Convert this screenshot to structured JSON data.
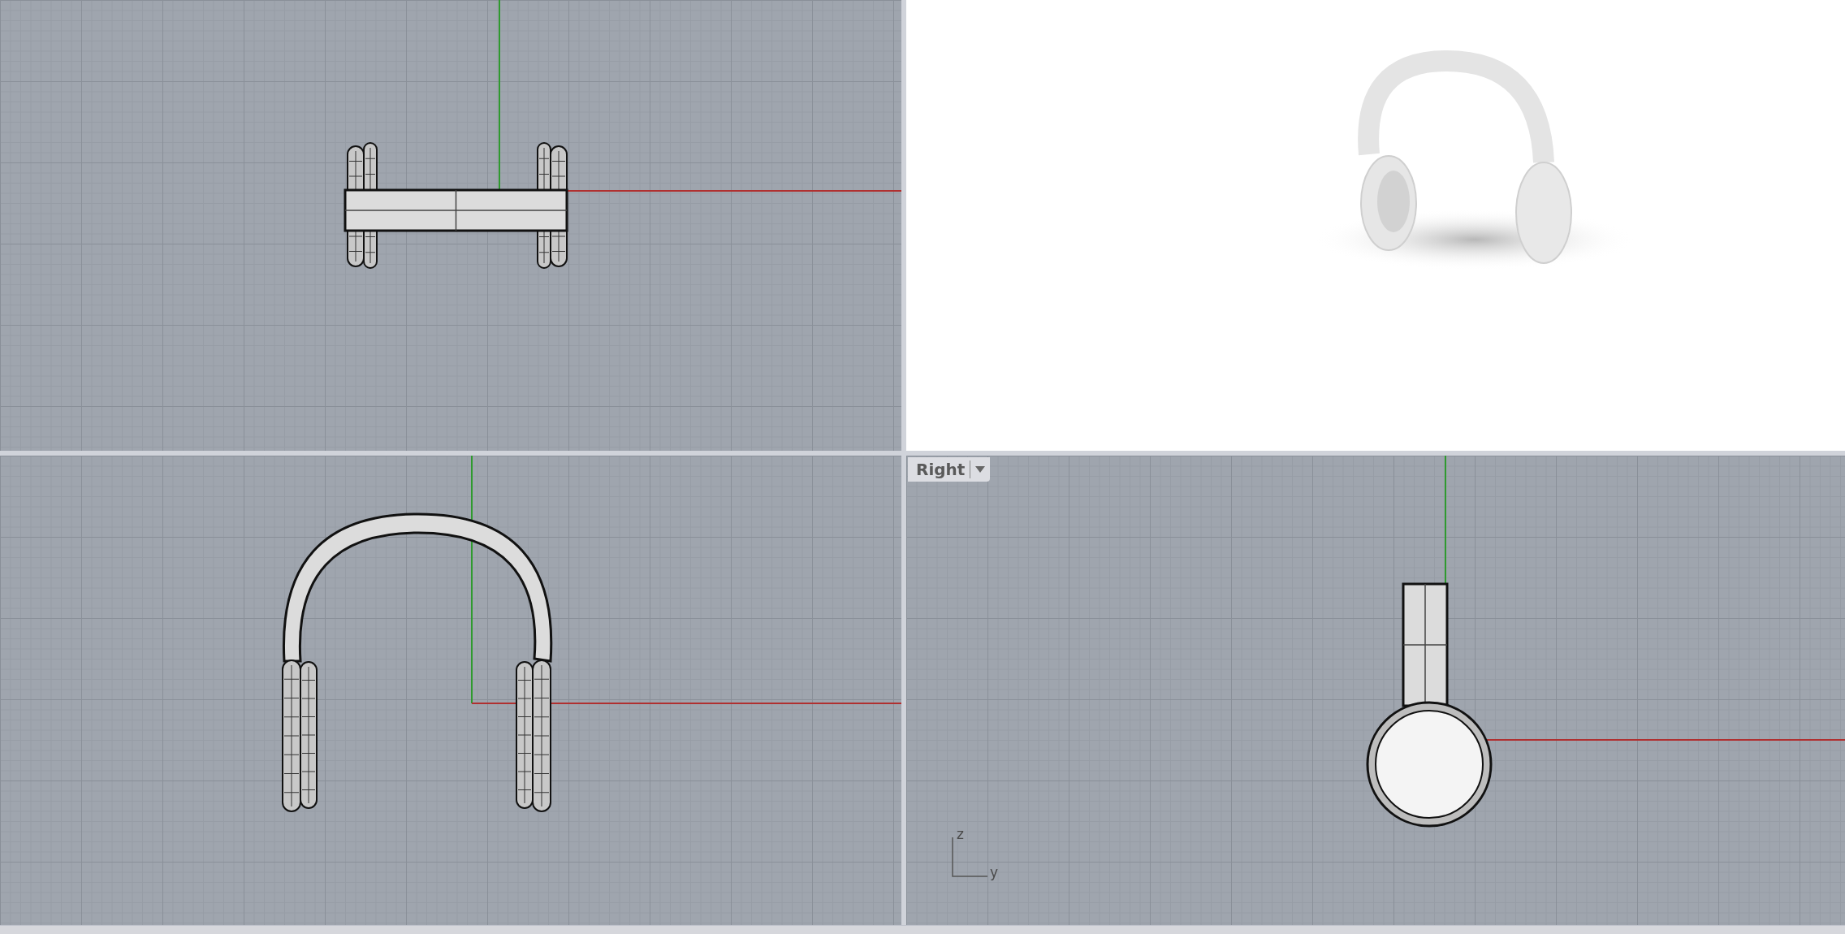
{
  "viewports": [
    {
      "kind": "top"
    },
    {
      "kind": "perspective"
    },
    {
      "kind": "front"
    },
    {
      "kind": "right",
      "label": "Right",
      "axis_labels": {
        "vertical": "z",
        "horizontal": "y"
      }
    }
  ]
}
